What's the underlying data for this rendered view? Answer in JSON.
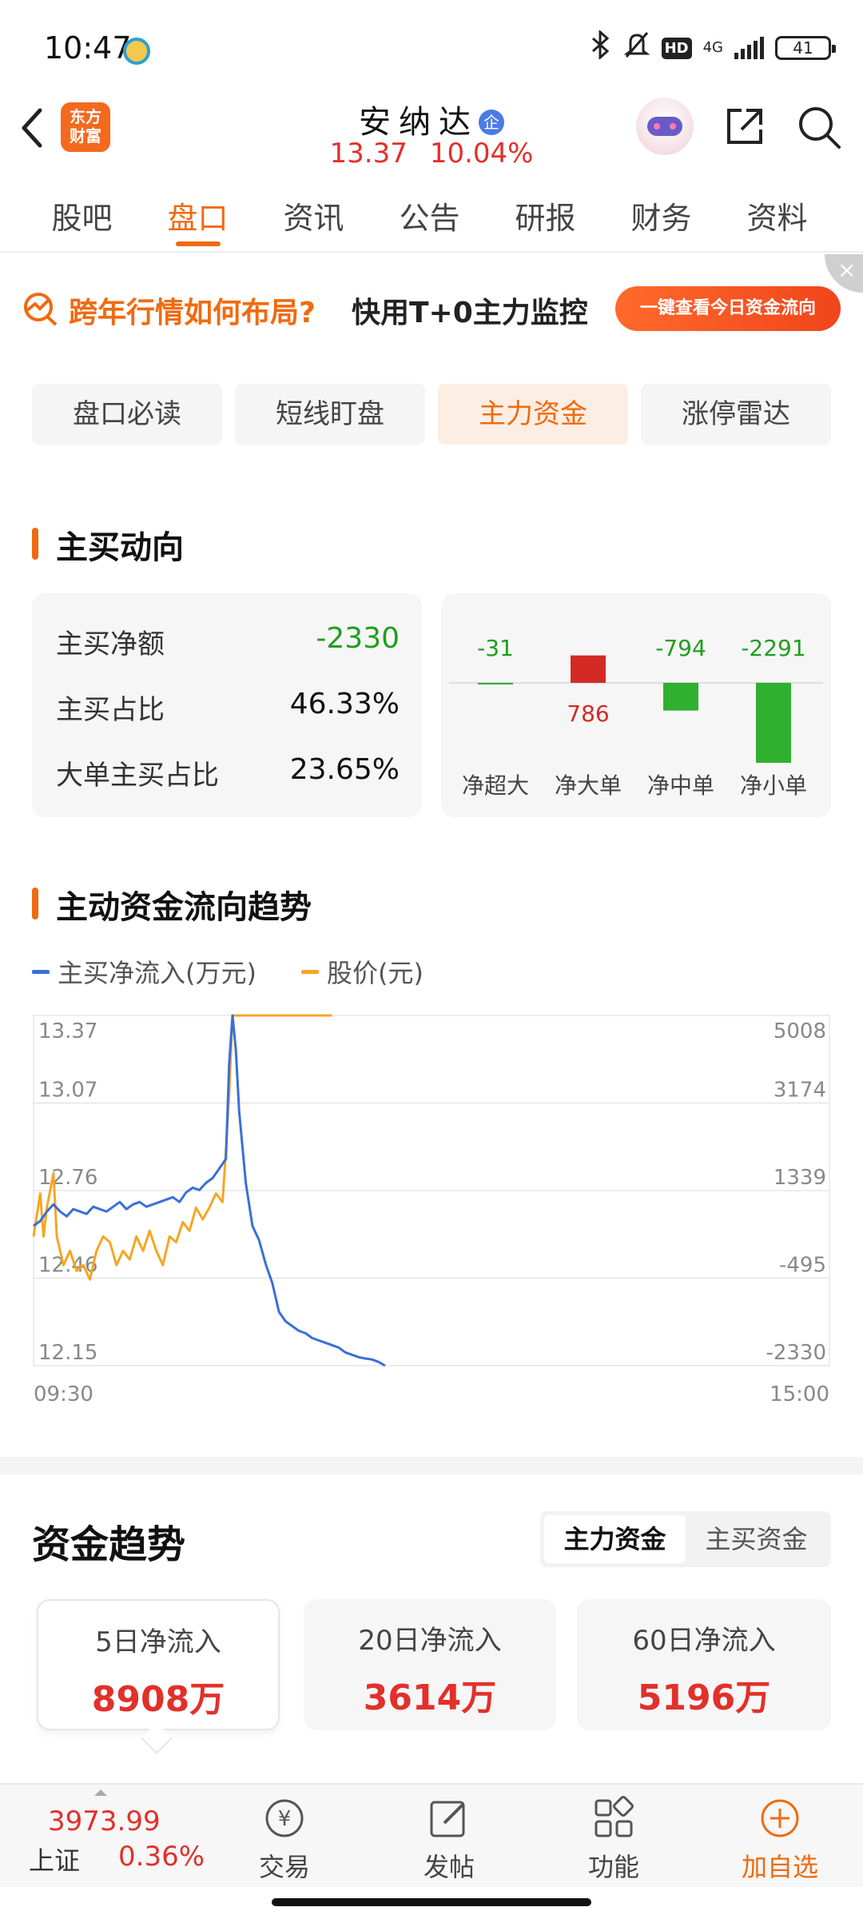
{
  "status_bar": {
    "time": "10:47",
    "network": "4G",
    "hd": "HD",
    "battery": "41"
  },
  "header": {
    "stock_name": "安纳达",
    "badge": "企",
    "price": "13.37",
    "change_pct": "10.04%",
    "logo_line1": "东方",
    "logo_line2": "财富"
  },
  "tabs": [
    "股吧",
    "盘口",
    "资讯",
    "公告",
    "研报",
    "财务",
    "资料"
  ],
  "promo": {
    "title": "跨年行情如何布局?",
    "subtitle": "快用T+0主力监控",
    "cta": "一键查看今日资金流向",
    "close": "×"
  },
  "segments": [
    "盘口必读",
    "短线盯盘",
    "主力资金",
    "涨停雷达"
  ],
  "main_buy": {
    "title": "主买动向",
    "rows": [
      {
        "label": "主买净额",
        "value": "-2330"
      },
      {
        "label": "主买占比",
        "value": "46.33%"
      },
      {
        "label": "大单主买占比",
        "value": "23.65%"
      }
    ],
    "bars": [
      {
        "label": "净超大",
        "value": -31,
        "value_text": "-31"
      },
      {
        "label": "净大单",
        "value": 786,
        "value_text": "786"
      },
      {
        "label": "净中单",
        "value": -794,
        "value_text": "-794"
      },
      {
        "label": "净小单",
        "value": -2291,
        "value_text": "-2291"
      }
    ]
  },
  "trend_section": {
    "title": "主动资金流向趋势",
    "legend": [
      {
        "label": "主买净流入(万元)",
        "color": "#3a6fd8"
      },
      {
        "label": "股价(元)",
        "color": "#f5a623"
      }
    ]
  },
  "chart_data": {
    "type": "line",
    "x_labels": [
      "09:30",
      "15:00"
    ],
    "y_left_ticks": [
      "13.37",
      "13.07",
      "12.76",
      "12.46",
      "12.15"
    ],
    "y_right_ticks": [
      "5008",
      "3174",
      "1339",
      "-495",
      "-2330"
    ],
    "ylim_left": [
      12.15,
      13.37
    ],
    "ylim_right": [
      -2330,
      5008
    ],
    "x_range": [
      0,
      240
    ],
    "grid": true,
    "series": [
      {
        "name": "主买净流入(万元)",
        "axis": "right",
        "color": "#3a6fd8",
        "points": [
          [
            0,
            600
          ],
          [
            2,
            700
          ],
          [
            4,
            900
          ],
          [
            6,
            1050
          ],
          [
            8,
            900
          ],
          [
            10,
            800
          ],
          [
            12,
            950
          ],
          [
            14,
            900
          ],
          [
            16,
            850
          ],
          [
            18,
            1000
          ],
          [
            20,
            950
          ],
          [
            22,
            900
          ],
          [
            24,
            1000
          ],
          [
            26,
            1100
          ],
          [
            28,
            950
          ],
          [
            30,
            1050
          ],
          [
            32,
            1100
          ],
          [
            34,
            1000
          ],
          [
            36,
            1050
          ],
          [
            38,
            1100
          ],
          [
            40,
            1150
          ],
          [
            42,
            1200
          ],
          [
            44,
            1100
          ],
          [
            46,
            1300
          ],
          [
            48,
            1400
          ],
          [
            50,
            1350
          ],
          [
            52,
            1500
          ],
          [
            54,
            1600
          ],
          [
            56,
            1800
          ],
          [
            58,
            2000
          ],
          [
            59,
            4000
          ],
          [
            60,
            5008
          ],
          [
            61,
            4300
          ],
          [
            62,
            3000
          ],
          [
            64,
            1500
          ],
          [
            66,
            600
          ],
          [
            68,
            300
          ],
          [
            70,
            -200
          ],
          [
            72,
            -600
          ],
          [
            74,
            -1200
          ],
          [
            76,
            -1400
          ],
          [
            78,
            -1500
          ],
          [
            80,
            -1600
          ],
          [
            82,
            -1650
          ],
          [
            84,
            -1750
          ],
          [
            86,
            -1800
          ],
          [
            88,
            -1850
          ],
          [
            90,
            -1900
          ],
          [
            92,
            -1950
          ],
          [
            94,
            -2050
          ],
          [
            96,
            -2100
          ],
          [
            98,
            -2150
          ],
          [
            100,
            -2180
          ],
          [
            102,
            -2200
          ],
          [
            104,
            -2250
          ],
          [
            106,
            -2330
          ]
        ]
      },
      {
        "name": "股价(元)",
        "axis": "left",
        "color": "#f5a623",
        "points": [
          [
            0,
            12.6
          ],
          [
            2,
            12.75
          ],
          [
            3,
            12.6
          ],
          [
            4,
            12.7
          ],
          [
            6,
            12.82
          ],
          [
            7,
            12.6
          ],
          [
            9,
            12.5
          ],
          [
            11,
            12.55
          ],
          [
            13,
            12.48
          ],
          [
            15,
            12.5
          ],
          [
            17,
            12.45
          ],
          [
            19,
            12.55
          ],
          [
            21,
            12.6
          ],
          [
            23,
            12.58
          ],
          [
            25,
            12.5
          ],
          [
            27,
            12.55
          ],
          [
            29,
            12.52
          ],
          [
            31,
            12.6
          ],
          [
            33,
            12.55
          ],
          [
            35,
            12.62
          ],
          [
            37,
            12.55
          ],
          [
            39,
            12.5
          ],
          [
            41,
            12.6
          ],
          [
            43,
            12.58
          ],
          [
            45,
            12.65
          ],
          [
            47,
            12.62
          ],
          [
            49,
            12.7
          ],
          [
            51,
            12.66
          ],
          [
            53,
            12.7
          ],
          [
            55,
            12.75
          ],
          [
            57,
            12.72
          ],
          [
            58,
            12.9
          ],
          [
            59,
            13.1
          ],
          [
            60,
            13.37
          ],
          [
            90,
            13.37
          ]
        ]
      }
    ]
  },
  "fund_trend": {
    "title": "资金趋势",
    "toggle": [
      "主力资金",
      "主买资金"
    ],
    "cards": [
      {
        "label": "5日净流入",
        "value": "8908万"
      },
      {
        "label": "20日净流入",
        "value": "3614万"
      },
      {
        "label": "60日净流入",
        "value": "5196万"
      }
    ]
  },
  "bottom_bar": {
    "index_value": "3973.99",
    "index_name": "上证",
    "index_change": "0.36%",
    "items": [
      "交易",
      "发帖",
      "功能",
      "加自选"
    ]
  }
}
